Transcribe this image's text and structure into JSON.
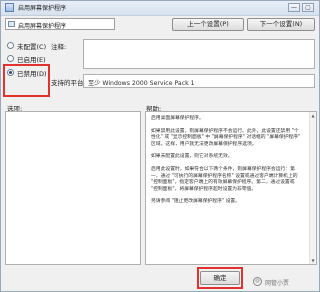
{
  "window": {
    "title": "启用屏幕保护程序",
    "min_glyph": "—",
    "max_glyph": "▢"
  },
  "header": {
    "setting_name": "启用屏幕保护程序"
  },
  "nav": {
    "prev_label": "上一个设置(P)",
    "next_label": "下一个设置(N)"
  },
  "radios": [
    {
      "label": "未配置(C)",
      "checked": false
    },
    {
      "label": "已启用(E)",
      "checked": false
    },
    {
      "label": "已禁用(D)",
      "checked": true
    }
  ],
  "comment": {
    "label": "注释:",
    "value": ""
  },
  "supported": {
    "label": "支持的平台:",
    "value": "至少 Windows 2000 Service Pack 1"
  },
  "options": {
    "label": "选项:"
  },
  "help": {
    "label": "帮助:",
    "paragraphs": [
      "启用桌面屏幕保护程序。",
      "如果禁用此设置，则屏幕保护程序不会运行。此外，此设置还禁用 \"个性化\" 或 \"显示控制面板\" 中 \"屏幕保护程序\" 对话框的 \"屏幕保护程序\" 区域。这样，用户就无法更改屏幕保护程序选项。",
      "如果未配置此设置，则它对系统无效。",
      "启用此设置时，如果符合以下两个条件，则屏幕保护程序会运行：第一，通过 \"可执行的屏幕保护程序名称\" 设置或通过客户端计算机上的 \"控制面板\"，指定客户端上的有效屏幕保护程序。第二，通过设置或 \"控制面板\"，将屏幕保护程序超时设置为非零值。",
      "另请参阅 \"阻止更改屏幕保护程序\" 设置。"
    ],
    "scroll_up": "▲",
    "scroll_down": "▼"
  },
  "footer": {
    "ok_label": "确定"
  },
  "watermark": {
    "text": "网管小贾",
    "icon_glyph": "◎"
  },
  "colors": {
    "highlight": "#e0332f",
    "titlebar": "#dbe4f0",
    "dialog_bg": "#f0f0f0"
  }
}
